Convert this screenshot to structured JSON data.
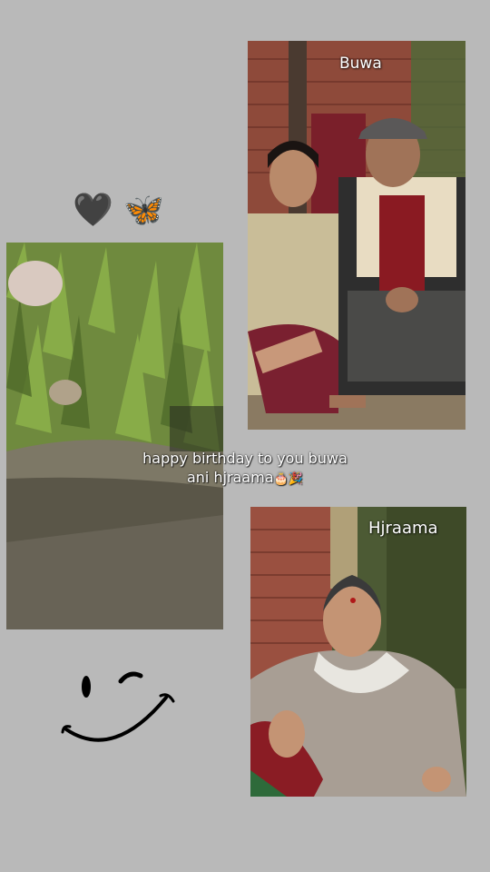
{
  "captions": {
    "top_photo": "Buwa",
    "bottom_photo": "Hjraama"
  },
  "greeting": {
    "line1": "happy birthday to you buwa",
    "line2": "ani hjraama",
    "line2_emojis": "🎂🎉"
  },
  "decor": {
    "heart": "🖤",
    "butterfly": "🦋",
    "smiley_icon": "winking-smiley-icon"
  },
  "colors": {
    "background": "#b9b9b9",
    "text": "#ffffff"
  }
}
